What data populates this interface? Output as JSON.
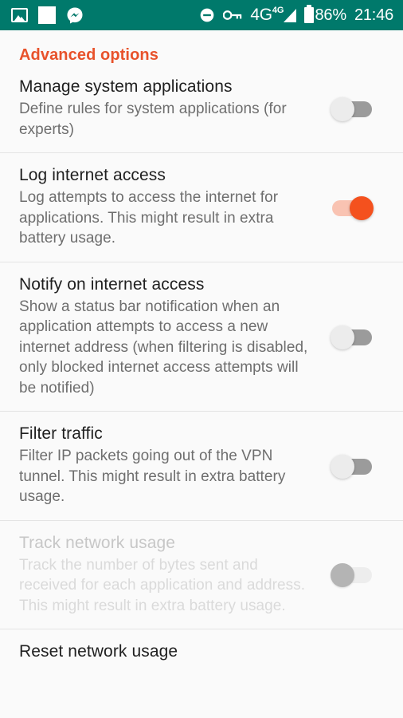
{
  "status_bar": {
    "background_color": "#00796b",
    "left_icons": [
      {
        "name": "photo-icon",
        "label": "image"
      },
      {
        "name": "blank-square-icon",
        "label": "blank"
      },
      {
        "name": "messenger-icon",
        "label": "messenger"
      }
    ],
    "right_icons": [
      {
        "name": "do-not-disturb-icon",
        "label": "do not disturb"
      },
      {
        "name": "vpn-key-icon",
        "label": "vpn key"
      }
    ],
    "network_type": "4G",
    "network_type_sup": "4G",
    "battery_percent": "86%",
    "clock": "21:46"
  },
  "screen": {
    "section_header": "Advanced options",
    "accent_color": "#e8522b"
  },
  "preferences": [
    {
      "key": "manage-system-applications",
      "title": "Manage system applications",
      "summary": "Define rules for system applications (for experts)",
      "switch_state": "off",
      "enabled": true
    },
    {
      "key": "log-internet-access",
      "title": "Log internet access",
      "summary": "Log attempts to access the internet for applications. This might result in extra battery usage.",
      "switch_state": "on",
      "enabled": true
    },
    {
      "key": "notify-on-internet-access",
      "title": "Notify on internet access",
      "summary": "Show a status bar notification when an application attempts to access a new internet address (when filtering is disabled, only blocked internet access attempts will be notified)",
      "switch_state": "off",
      "enabled": true
    },
    {
      "key": "filter-traffic",
      "title": "Filter traffic",
      "summary": "Filter IP packets going out of the VPN tunnel. This might result in extra battery usage.",
      "switch_state": "off",
      "enabled": true
    },
    {
      "key": "track-network-usage",
      "title": "Track network usage",
      "summary": "Track the number of bytes sent and received for each application and address. This might result in extra battery usage.",
      "switch_state": "off",
      "enabled": false
    },
    {
      "key": "reset-network-usage",
      "title": "Reset network usage",
      "summary": "",
      "switch_state": "none",
      "enabled": true
    }
  ]
}
